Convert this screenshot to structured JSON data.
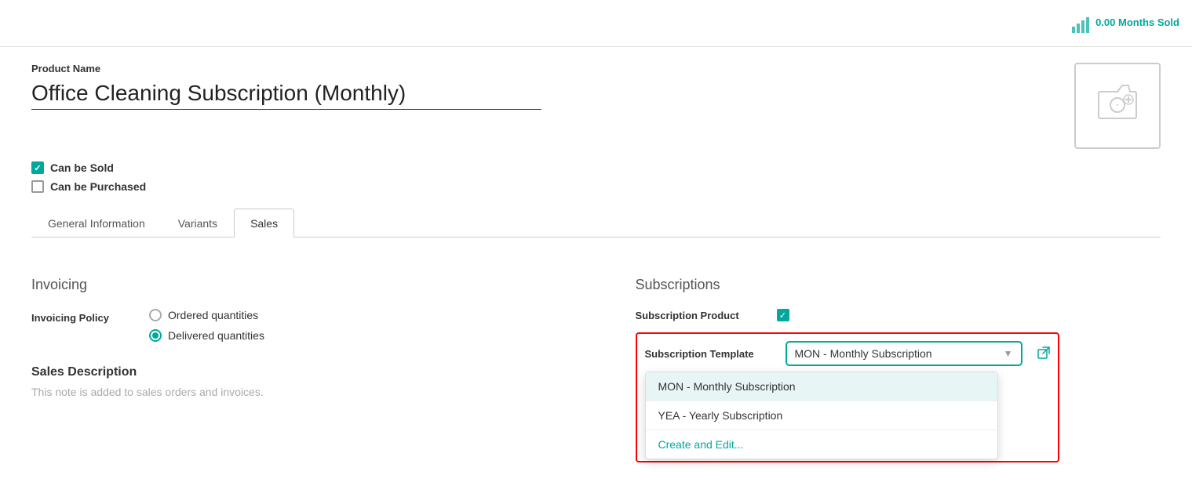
{
  "topbar": {
    "months_sold_value": "0.00",
    "months_sold_label": "Months Sold"
  },
  "form": {
    "product_name_label": "Product Name",
    "product_name_value": "Office Cleaning Subscription (Monthly)"
  },
  "checkboxes": {
    "can_be_sold_label": "Can be Sold",
    "can_be_sold_checked": true,
    "can_be_purchased_label": "Can be Purchased",
    "can_be_purchased_checked": false
  },
  "tabs": [
    {
      "id": "general",
      "label": "General Information"
    },
    {
      "id": "variants",
      "label": "Variants"
    },
    {
      "id": "sales",
      "label": "Sales"
    }
  ],
  "active_tab": "sales",
  "invoicing": {
    "section_title": "Invoicing",
    "policy_label": "Invoicing Policy",
    "options": [
      {
        "id": "ordered",
        "label": "Ordered quantities",
        "selected": false
      },
      {
        "id": "delivered",
        "label": "Delivered quantities",
        "selected": true
      }
    ]
  },
  "sales_description": {
    "title": "Sales Description",
    "hint": "This note is added to sales orders and invoices."
  },
  "subscriptions": {
    "section_title": "Subscriptions",
    "product_label": "Subscription Product",
    "product_checked": true,
    "template_label": "Subscription Template",
    "template_value": "MON - Monthly Subscription",
    "dropdown_options": [
      {
        "id": "mon",
        "label": "MON - Monthly Subscription",
        "highlighted": true
      },
      {
        "id": "yea",
        "label": "YEA - Yearly Subscription",
        "highlighted": false
      }
    ],
    "create_edit_label": "Create and Edit..."
  }
}
